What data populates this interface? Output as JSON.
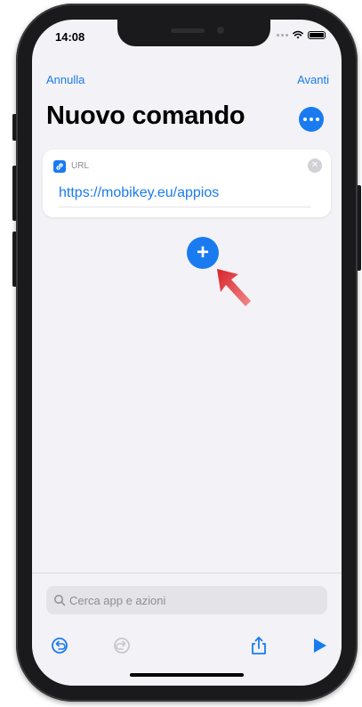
{
  "status_bar": {
    "time": "14:08"
  },
  "nav": {
    "cancel_label": "Annulla",
    "next_label": "Avanti"
  },
  "header": {
    "title": "Nuovo comando"
  },
  "action_card": {
    "label": "URL",
    "value": "https://mobikey.eu/appios"
  },
  "search": {
    "placeholder": "Cerca app e azioni"
  },
  "icons": {
    "more": "ellipsis-icon",
    "link": "link-icon",
    "clear": "close-icon",
    "add": "plus-icon",
    "pointer": "arrow-pointer-icon",
    "search": "search-icon",
    "undo": "undo-icon",
    "redo": "redo-icon",
    "share": "share-icon",
    "play": "play-icon"
  },
  "colors": {
    "accent": "#1a7bf0",
    "pointer": "#e0302b"
  }
}
